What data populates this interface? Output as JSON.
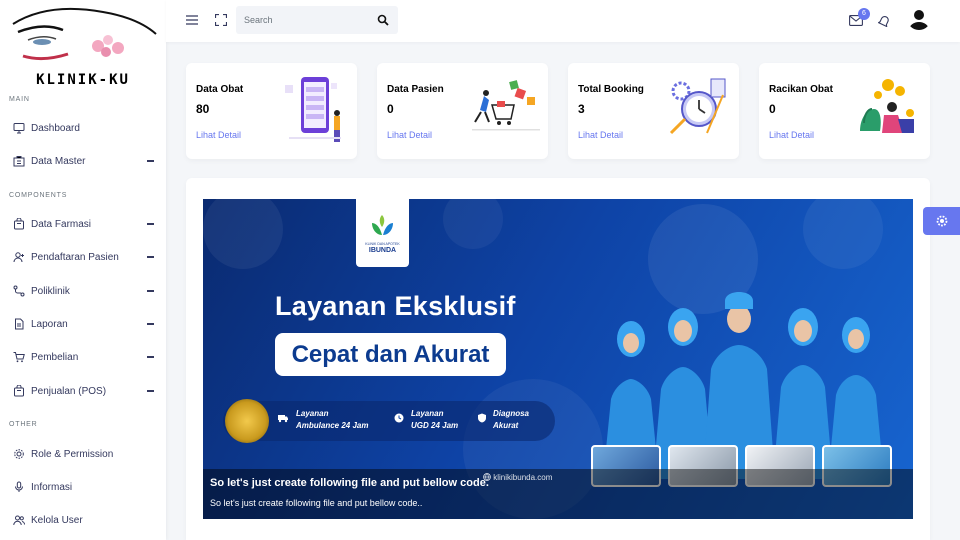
{
  "brand": {
    "name": "KLINIK-KU"
  },
  "sidebar": {
    "sections": [
      {
        "label": "MAIN"
      },
      {
        "label": "COMPONENTS"
      },
      {
        "label": "OTHER"
      }
    ],
    "items": [
      {
        "label": "Dashboard",
        "icon": "monitor-icon"
      },
      {
        "label": "Data Master",
        "icon": "building-icon"
      },
      {
        "label": "Data Farmasi",
        "icon": "bag-icon"
      },
      {
        "label": "Pendaftaran Pasien",
        "icon": "user-plus-icon"
      },
      {
        "label": "Poliklinik",
        "icon": "route-icon"
      },
      {
        "label": "Laporan",
        "icon": "file-icon"
      },
      {
        "label": "Pembelian",
        "icon": "cart-icon"
      },
      {
        "label": "Penjualan (POS)",
        "icon": "bag-icon"
      },
      {
        "label": "Role & Permission",
        "icon": "gear-icon"
      },
      {
        "label": "Informasi",
        "icon": "microphone-icon"
      },
      {
        "label": "Kelola User",
        "icon": "users-icon"
      }
    ]
  },
  "topbar": {
    "search_placeholder": "Search",
    "mail_count": "6"
  },
  "cards": [
    {
      "title": "Data Obat",
      "value": "80",
      "link": "Lihat Detail"
    },
    {
      "title": "Data Pasien",
      "value": "0",
      "link": "Lihat Detail"
    },
    {
      "title": "Total Booking",
      "value": "3",
      "link": "Lihat Detail"
    },
    {
      "title": "Racikan Obat",
      "value": "0",
      "link": "Lihat Detail"
    }
  ],
  "banner": {
    "logo_text": "IBUNDA",
    "logo_sub": "KLINIK DAN APOTEK",
    "headline": "Layanan Eksklusif",
    "pill": "Cepat dan Akurat",
    "services": [
      {
        "line1": "Layanan",
        "line2": "Ambulance 24 Jam"
      },
      {
        "line1": "Layanan",
        "line2": "UGD 24 Jam"
      },
      {
        "line1": "Diagnosa",
        "line2": "Akurat"
      }
    ],
    "website": "klinikibunda.com",
    "caption_title": "So let's just create following file and put bellow code.",
    "caption_text": "So let's just create following file and put bellow code.."
  },
  "colors": {
    "accent": "#6777ef",
    "banner_blue": "#0e43a6"
  }
}
